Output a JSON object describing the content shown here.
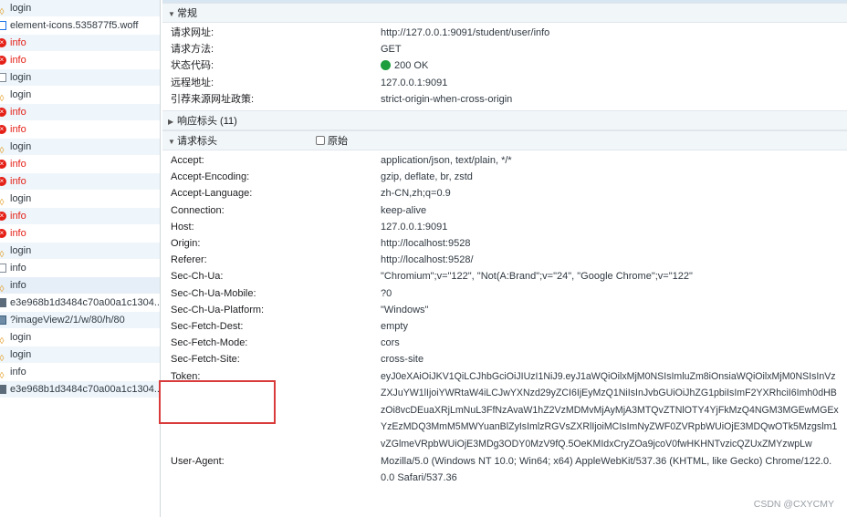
{
  "requests": [
    {
      "name": "login",
      "type": "js",
      "error": false
    },
    {
      "name": "element-icons.535877f5.woff",
      "type": "font",
      "error": false
    },
    {
      "name": "info",
      "type": "err",
      "error": true
    },
    {
      "name": "info",
      "type": "err",
      "error": true
    },
    {
      "name": "login",
      "type": "doc",
      "error": false
    },
    {
      "name": "login",
      "type": "js",
      "error": false
    },
    {
      "name": "info",
      "type": "err",
      "error": true
    },
    {
      "name": "info",
      "type": "err",
      "error": true
    },
    {
      "name": "login",
      "type": "js",
      "error": false
    },
    {
      "name": "info",
      "type": "err",
      "error": true
    },
    {
      "name": "info",
      "type": "err",
      "error": true
    },
    {
      "name": "login",
      "type": "js",
      "error": false
    },
    {
      "name": "info",
      "type": "err",
      "error": true
    },
    {
      "name": "info",
      "type": "err",
      "error": true
    },
    {
      "name": "login",
      "type": "js",
      "error": false
    },
    {
      "name": "info",
      "type": "doc",
      "error": false
    },
    {
      "name": "info",
      "type": "js",
      "error": false,
      "selected": true
    },
    {
      "name": "e3e968b1d3484c70a00a1c1304...",
      "type": "img",
      "error": false
    },
    {
      "name": "?imageView2/1/w/80/h/80",
      "type": "imgsm",
      "error": false
    },
    {
      "name": "login",
      "type": "js",
      "error": false
    },
    {
      "name": "login",
      "type": "js",
      "error": false
    },
    {
      "name": "info",
      "type": "js",
      "error": false
    },
    {
      "name": "e3e968b1d3484c70a00a1c1304...",
      "type": "img",
      "error": false
    }
  ],
  "general": {
    "title": "常规",
    "rows": [
      {
        "k": "请求网址:",
        "v": "http://127.0.0.1:9091/student/user/info"
      },
      {
        "k": "请求方法:",
        "v": "GET"
      },
      {
        "k": "状态代码:",
        "v": "200 OK",
        "status": true
      },
      {
        "k": "远程地址:",
        "v": "127.0.0.1:9091"
      },
      {
        "k": "引荐来源网址政策:",
        "v": "strict-origin-when-cross-origin"
      }
    ]
  },
  "response_headers": {
    "title": "响应标头 (11)"
  },
  "request_headers": {
    "title": "请求标头",
    "raw_label": "原始",
    "rows": [
      {
        "k": "Accept:",
        "v": "application/json, text/plain, */*"
      },
      {
        "k": "Accept-Encoding:",
        "v": "gzip, deflate, br, zstd"
      },
      {
        "k": "Accept-Language:",
        "v": "zh-CN,zh;q=0.9"
      },
      {
        "k": "Connection:",
        "v": "keep-alive"
      },
      {
        "k": "Host:",
        "v": "127.0.0.1:9091"
      },
      {
        "k": "Origin:",
        "v": "http://localhost:9528"
      },
      {
        "k": "Referer:",
        "v": "http://localhost:9528/"
      },
      {
        "k": "Sec-Ch-Ua:",
        "v": "\"Chromium\";v=\"122\", \"Not(A:Brand\";v=\"24\", \"Google Chrome\";v=\"122\""
      },
      {
        "k": "Sec-Ch-Ua-Mobile:",
        "v": "?0"
      },
      {
        "k": "Sec-Ch-Ua-Platform:",
        "v": "\"Windows\""
      },
      {
        "k": "Sec-Fetch-Dest:",
        "v": "empty"
      },
      {
        "k": "Sec-Fetch-Mode:",
        "v": "cors"
      },
      {
        "k": "Sec-Fetch-Site:",
        "v": "cross-site"
      },
      {
        "k": "Token:",
        "v": "eyJ0eXAiOiJKV1QiLCJhbGciOiJIUzI1NiJ9.eyJ1aWQiOilxMjM0NSIsImluZm8iOnsiaWQiOilxMjM0NSIsInVzZXJuYW1lIjoiYWRtaW4iLCJwYXNzd29yZCI6IjEyMzQ1NiIsInJvbGUiOiJhZG1pbiIsImF2YXRhciI6Imh0dHBzOi8vcDEuaXRjLmNuL3FfNzAvaW1hZ2VzMDMvMjAyMjA3MTQvZTNlOTY4YjFkMzQ4NGM3MGEwMGExYzEzMDQ3MmM5MWYuanBlZyIsImlzRGVsZXRlIjoiMCIsImNyZWF0ZVRpbWUiOjE3MDQwOTk5Mzgslm1vZGlmeVRpbWUiOjE3MDg3ODY0MzV9fQ.5OeKMIdxCryZOa9jcoV0fwHKHNTvzicQZUxZMYzwpLw",
        "token": true
      },
      {
        "k": "User-Agent:",
        "v": "Mozilla/5.0 (Windows NT 10.0; Win64; x64) AppleWebKit/537.36 (KHTML, like Gecko) Chrome/122.0.0.0 Safari/537.36"
      }
    ]
  },
  "watermark": "CSDN @CXYCMY",
  "colors": {
    "error": "#e52017",
    "status_ok": "#1e9e3f",
    "highlight_box": "#d93b3b"
  }
}
